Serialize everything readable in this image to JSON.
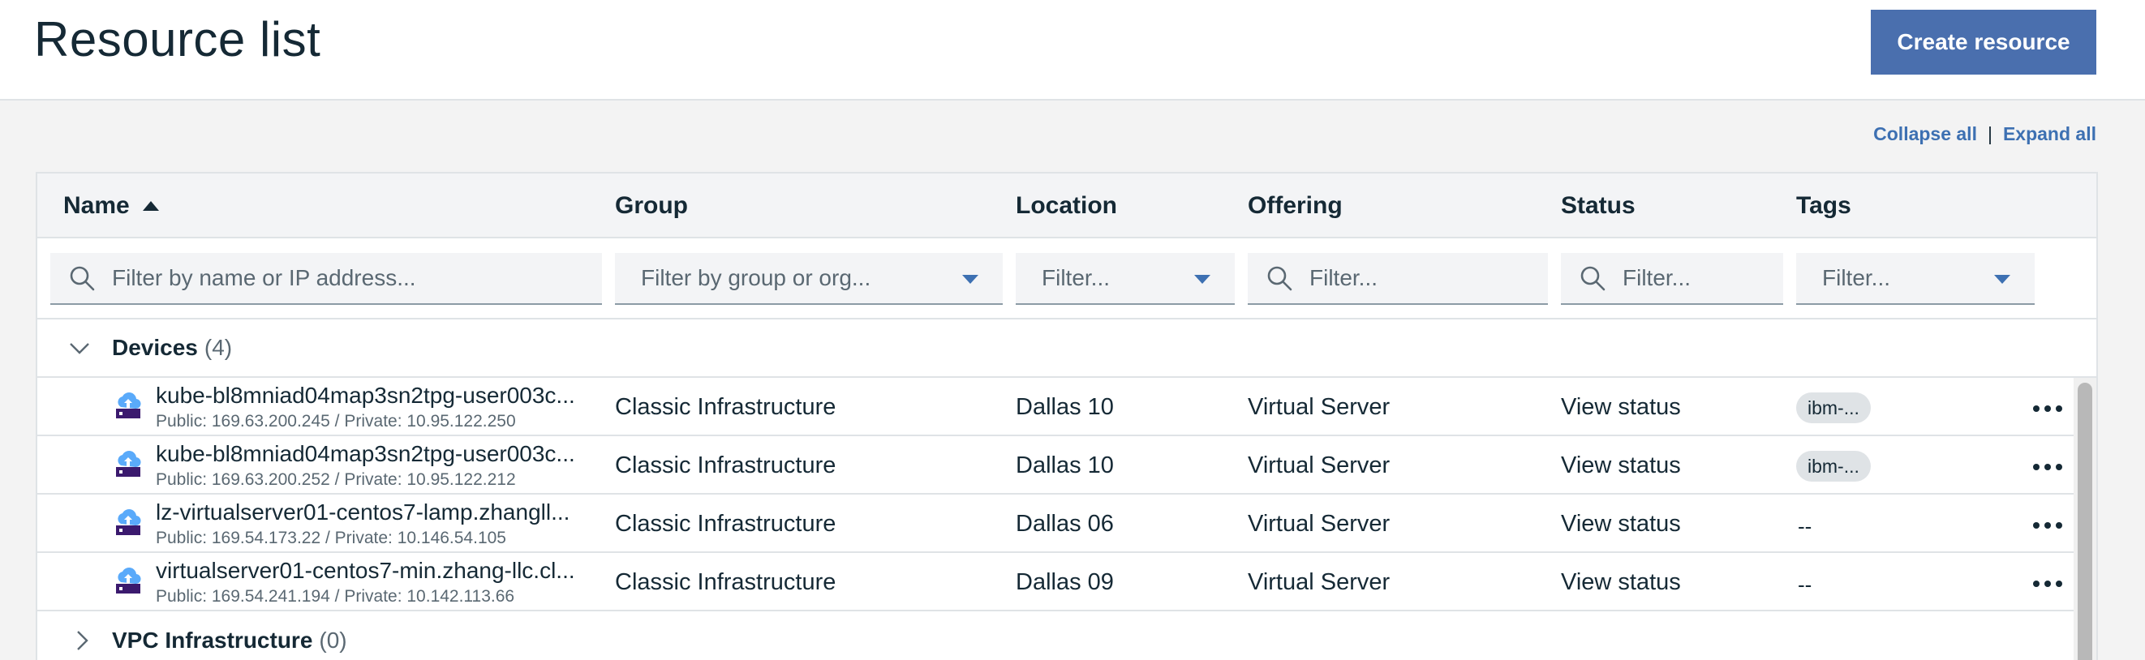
{
  "header": {
    "title": "Resource list",
    "create_button_label": "Create resource"
  },
  "toolbar": {
    "collapse_all": "Collapse all",
    "separator": "|",
    "expand_all": "Expand all"
  },
  "table": {
    "columns": [
      "Name",
      "Group",
      "Location",
      "Offering",
      "Status",
      "Tags"
    ],
    "sort": {
      "column": "Name",
      "direction": "ascending"
    },
    "filters": {
      "name": "Filter by name or IP address...",
      "group": "Filter by group or org...",
      "location": "Filter...",
      "offering": "Filter...",
      "status": "Filter...",
      "tags": "Filter..."
    },
    "groups": [
      {
        "name": "Devices",
        "count": "(4)",
        "expanded": true
      },
      {
        "name": "VPC Infrastructure",
        "count": "(0)",
        "expanded": false
      }
    ],
    "rows": [
      {
        "name": "kube-bl8mniad04map3sn2tpg-user003c...",
        "ips": "Public: 169.63.200.245 / Private: 10.95.122.250",
        "group": "Classic Infrastructure",
        "location": "Dallas 10",
        "offering": "Virtual Server",
        "status": "View status",
        "tag": "ibm-..."
      },
      {
        "name": "kube-bl8mniad04map3sn2tpg-user003c...",
        "ips": "Public: 169.63.200.252 / Private: 10.95.122.212",
        "group": "Classic Infrastructure",
        "location": "Dallas 10",
        "offering": "Virtual Server",
        "status": "View status",
        "tag": "ibm-..."
      },
      {
        "name": "lz-virtualserver01-centos7-lamp.zhangll...",
        "ips": "Public: 169.54.173.22 / Private: 10.146.54.105",
        "group": "Classic Infrastructure",
        "location": "Dallas 06",
        "offering": "Virtual Server",
        "status": "View status",
        "tag": "--"
      },
      {
        "name": "virtualserver01-centos7-min.zhang-llc.cl...",
        "ips": "Public: 169.54.241.194 / Private: 10.142.113.66",
        "group": "Classic Infrastructure",
        "location": "Dallas 09",
        "offering": "Virtual Server",
        "status": "View status",
        "tag": "--"
      }
    ]
  },
  "icons": {
    "resource": "virtual-server-cloud-icon",
    "row_menu": "overflow-menu-icon",
    "search": "search-icon",
    "dropdown": "caret-down-icon",
    "group_expanded": "chevron-down-icon",
    "group_collapsed": "chevron-right-icon"
  },
  "colors": {
    "primary_button": "#4a6fae",
    "link": "#3d70b2",
    "text": "#152935",
    "muted_text": "#5a6872",
    "tag_bg": "#dfe3e6",
    "icon_cloud": "#5aaafa",
    "icon_base": "#3b1a6e"
  }
}
